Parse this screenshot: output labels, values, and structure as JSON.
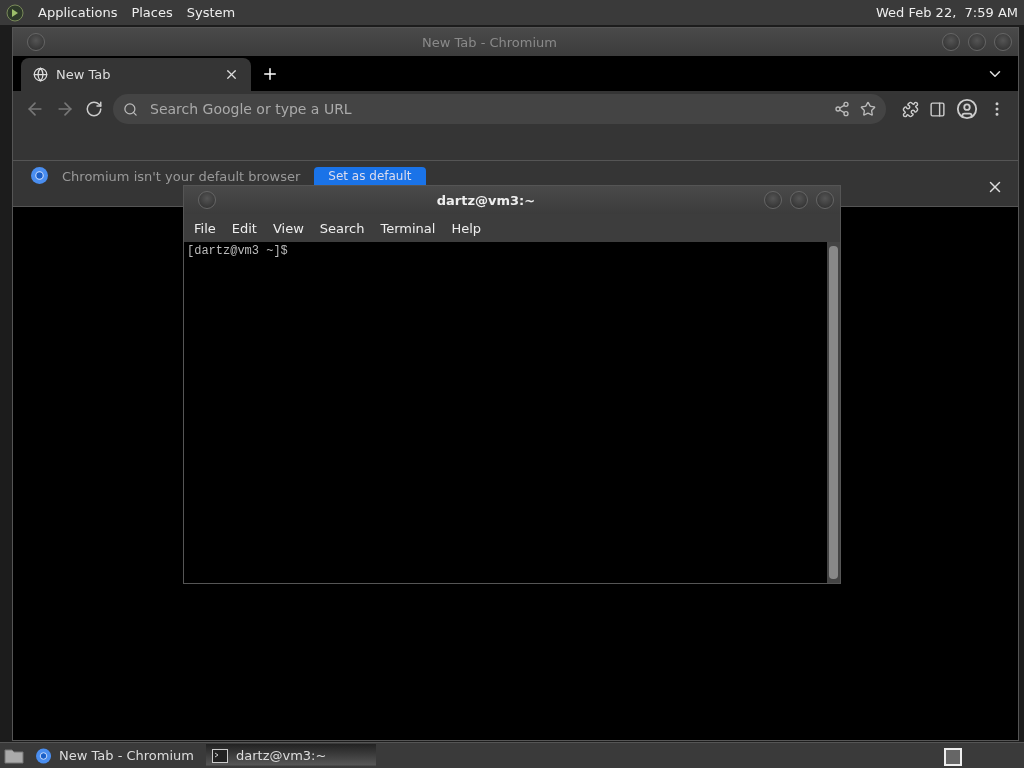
{
  "top_panel": {
    "menus": [
      "Applications",
      "Places",
      "System"
    ],
    "clock": "Wed Feb 22,  7:59 AM"
  },
  "browser": {
    "title": "New Tab - Chromium",
    "tabs": [
      {
        "label": "New Tab",
        "selected": true
      }
    ],
    "address": {
      "placeholder": "Search Google or type a URL"
    },
    "infobar": {
      "message": "Chromium isn't your default browser",
      "button": "Set as default"
    }
  },
  "terminal": {
    "title": "dartz@vm3:~",
    "menus": [
      "File",
      "Edit",
      "View",
      "Search",
      "Terminal",
      "Help"
    ],
    "lines": [
      "[dartz@vm3 ~]$"
    ]
  },
  "taskbar": {
    "tasks": [
      {
        "label": "New Tab - Chromium",
        "kind": "browser",
        "selected": false
      },
      {
        "label": "dartz@vm3:~",
        "kind": "terminal",
        "selected": true
      }
    ]
  }
}
